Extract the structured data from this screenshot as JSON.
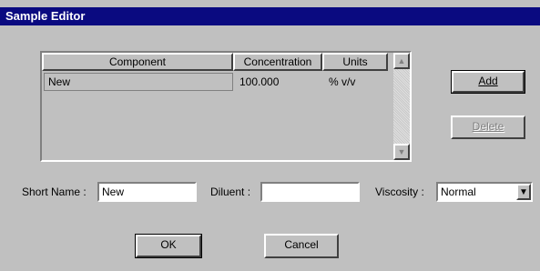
{
  "window": {
    "title": "Sample Editor"
  },
  "grid": {
    "columns": [
      "Component",
      "Concentration",
      "Units"
    ],
    "rows": [
      {
        "component": "New",
        "concentration": "100.000",
        "units": "% v/v"
      }
    ]
  },
  "buttons": {
    "add": "Add",
    "delete": "Delete",
    "ok": "OK",
    "cancel": "Cancel"
  },
  "fields": {
    "short_name_label": "Short Name :",
    "short_name_value": "New",
    "diluent_label": "Diluent :",
    "diluent_value": "",
    "viscosity_label": "Viscosity :",
    "viscosity_value": "Normal"
  },
  "icons": {
    "scroll_up": "scroll-up-arrow",
    "scroll_down": "scroll-down-arrow",
    "dropdown": "dropdown-arrow"
  }
}
